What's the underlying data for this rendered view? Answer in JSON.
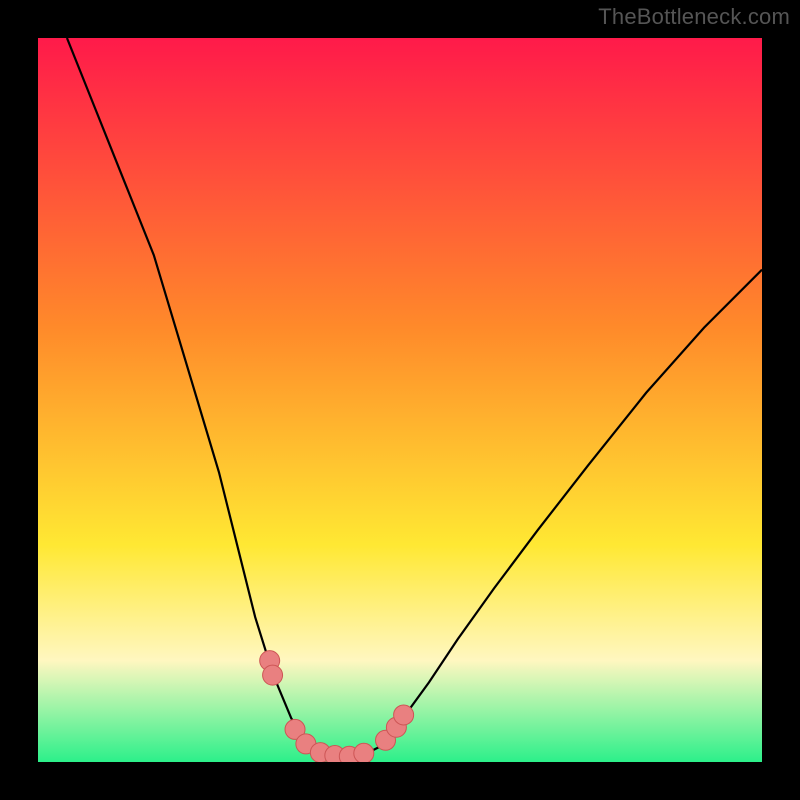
{
  "watermark": "TheBottleneck.com",
  "colors": {
    "frame": "#000000",
    "curve": "#000000",
    "marker_fill": "#e98080",
    "marker_stroke": "#cd5555",
    "grad_top": "#ff1a4a",
    "grad_mid1": "#ff8a2a",
    "grad_mid2": "#ffe833",
    "grad_band": "#fff7c0",
    "grad_bottom": "#2cf08a"
  },
  "chart_data": {
    "type": "line",
    "title": "",
    "xlabel": "",
    "ylabel": "",
    "xlim": [
      0,
      100
    ],
    "ylim": [
      0,
      100
    ],
    "curve_points": [
      {
        "x": 4.0,
        "y": 100.0
      },
      {
        "x": 8.0,
        "y": 90.0
      },
      {
        "x": 12.0,
        "y": 80.0
      },
      {
        "x": 16.0,
        "y": 70.0
      },
      {
        "x": 19.0,
        "y": 60.0
      },
      {
        "x": 22.0,
        "y": 50.0
      },
      {
        "x": 25.0,
        "y": 40.0
      },
      {
        "x": 27.5,
        "y": 30.0
      },
      {
        "x": 30.0,
        "y": 20.0
      },
      {
        "x": 32.5,
        "y": 12.0
      },
      {
        "x": 35.0,
        "y": 6.0
      },
      {
        "x": 38.0,
        "y": 2.0
      },
      {
        "x": 41.0,
        "y": 0.5
      },
      {
        "x": 44.0,
        "y": 0.5
      },
      {
        "x": 47.0,
        "y": 2.0
      },
      {
        "x": 50.0,
        "y": 5.5
      },
      {
        "x": 54.0,
        "y": 11.0
      },
      {
        "x": 58.0,
        "y": 17.0
      },
      {
        "x": 63.0,
        "y": 24.0
      },
      {
        "x": 69.0,
        "y": 32.0
      },
      {
        "x": 76.0,
        "y": 41.0
      },
      {
        "x": 84.0,
        "y": 51.0
      },
      {
        "x": 92.0,
        "y": 60.0
      },
      {
        "x": 100.0,
        "y": 68.0
      }
    ],
    "markers": [
      {
        "x": 32.0,
        "y": 14.0
      },
      {
        "x": 32.4,
        "y": 12.0
      },
      {
        "x": 35.5,
        "y": 4.5
      },
      {
        "x": 37.0,
        "y": 2.5
      },
      {
        "x": 39.0,
        "y": 1.3
      },
      {
        "x": 41.0,
        "y": 0.9
      },
      {
        "x": 43.0,
        "y": 0.8
      },
      {
        "x": 45.0,
        "y": 1.2
      },
      {
        "x": 48.0,
        "y": 3.0
      },
      {
        "x": 49.5,
        "y": 4.8
      },
      {
        "x": 50.5,
        "y": 6.5
      }
    ]
  }
}
